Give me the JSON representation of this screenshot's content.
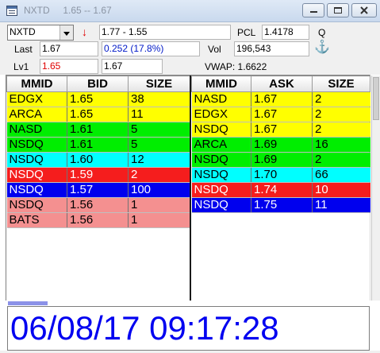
{
  "window": {
    "title": "NXTD",
    "subtitle": "1.65 -- 1.67",
    "colors": {
      "titlebar": "#d3e0f1",
      "title_text": "#8a94a3"
    }
  },
  "quote": {
    "symbol": "NXTD",
    "direction_icon": "down-arrow-icon",
    "range": "1.77 - 1.55",
    "pcl_label": "PCL",
    "pcl_value": "1.4178",
    "q_label": "Q",
    "last_label": "Last",
    "last_value": "1.67",
    "change_value": "0.252  (17.8%)",
    "vol_label": "Vol",
    "vol_value": "196,543",
    "anchor_icon": "anchor-icon",
    "lv1_label": "Lv1",
    "lv1_bid": "1.65",
    "lv1_ask": "1.67",
    "vwap_text": "VWAP: 1.6622"
  },
  "level_colors": {
    "yellow": "#ffff00",
    "green": "#00ee00",
    "cyan": "#00ffff",
    "red": "#f51d1d",
    "blue": "#0000ee",
    "salmon": "#f49090"
  },
  "bids": {
    "headers": [
      "MMID",
      "BID",
      "SIZE"
    ],
    "rows": [
      {
        "mmid": "EDGX",
        "price": "1.65",
        "size": "38",
        "color": "yellow"
      },
      {
        "mmid": "ARCA",
        "price": "1.65",
        "size": "11",
        "color": "yellow"
      },
      {
        "mmid": "NASD",
        "price": "1.61",
        "size": "5",
        "color": "green"
      },
      {
        "mmid": "NSDQ",
        "price": "1.61",
        "size": "5",
        "color": "green"
      },
      {
        "mmid": "NSDQ",
        "price": "1.60",
        "size": "12",
        "color": "cyan"
      },
      {
        "mmid": "NSDQ",
        "price": "1.59",
        "size": "2",
        "color": "red"
      },
      {
        "mmid": "NSDQ",
        "price": "1.57",
        "size": "100",
        "color": "blue"
      },
      {
        "mmid": "NSDQ",
        "price": "1.56",
        "size": "1",
        "color": "salmon"
      },
      {
        "mmid": "BATS",
        "price": "1.56",
        "size": "1",
        "color": "salmon"
      }
    ]
  },
  "asks": {
    "headers": [
      "MMID",
      "ASK",
      "SIZE"
    ],
    "rows": [
      {
        "mmid": "NASD",
        "price": "1.67",
        "size": "2",
        "color": "yellow"
      },
      {
        "mmid": "EDGX",
        "price": "1.67",
        "size": "2",
        "color": "yellow"
      },
      {
        "mmid": "NSDQ",
        "price": "1.67",
        "size": "2",
        "color": "yellow"
      },
      {
        "mmid": "ARCA",
        "price": "1.69",
        "size": "16",
        "color": "green"
      },
      {
        "mmid": "NSDQ",
        "price": "1.69",
        "size": "2",
        "color": "green"
      },
      {
        "mmid": "NSDQ",
        "price": "1.70",
        "size": "66",
        "color": "cyan"
      },
      {
        "mmid": "NSDQ",
        "price": "1.74",
        "size": "10",
        "color": "red"
      },
      {
        "mmid": "NSDQ",
        "price": "1.75",
        "size": "11",
        "color": "blue"
      }
    ]
  },
  "progress": {
    "fraction": 0.11,
    "color": "#8c92e8"
  },
  "clock": {
    "text": "06/08/17 09:17:28",
    "color": "#0000f0"
  }
}
